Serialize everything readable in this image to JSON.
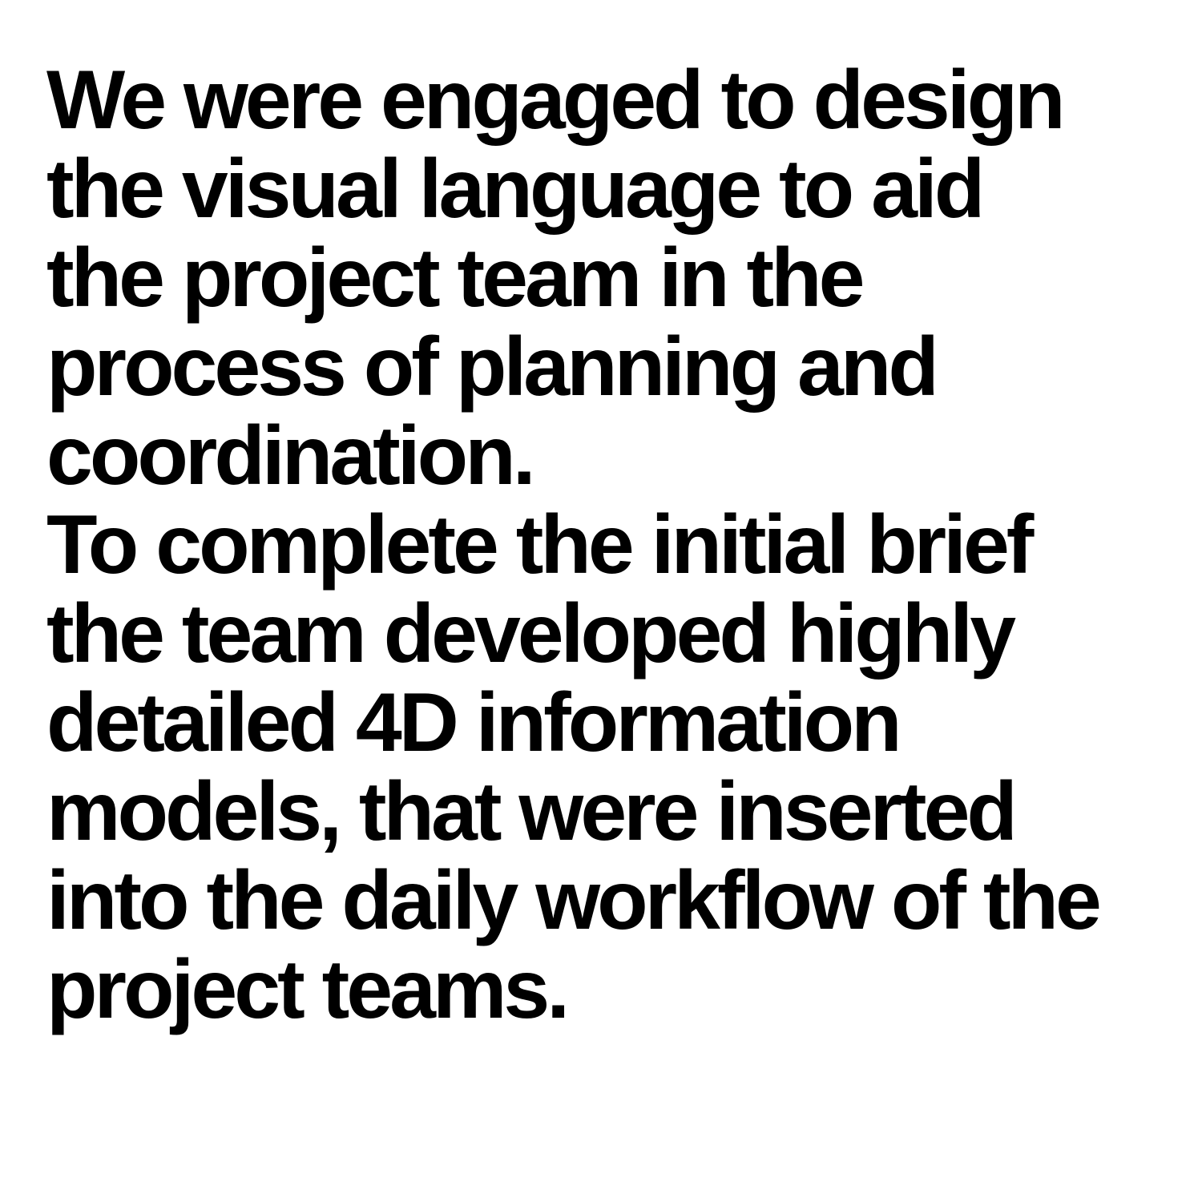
{
  "document": {
    "paragraphs": [
      {
        "lines": [
          "We were engaged to design",
          "the visual language to aid",
          "the project team in the",
          "process of planning and",
          "coordination."
        ]
      },
      {
        "lines": [
          "To complete the initial brief",
          "the team developed highly",
          "detailed 4D information",
          "models, that were inserted",
          "into the daily workflow of the",
          "project teams."
        ]
      }
    ]
  }
}
